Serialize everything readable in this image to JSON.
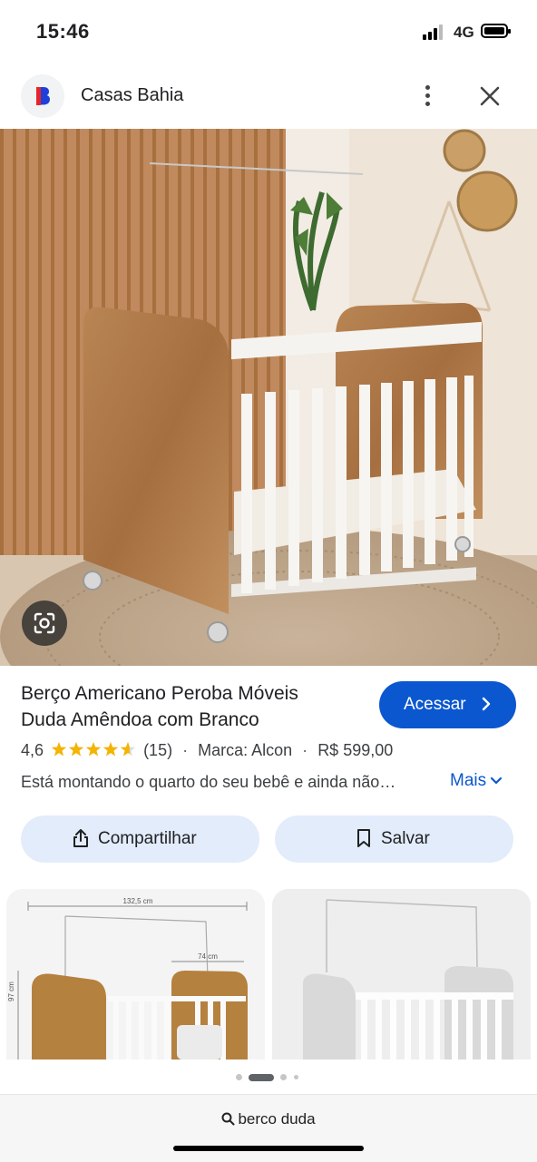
{
  "status_bar": {
    "time": "15:46",
    "network": "4G",
    "signal_bars": 3,
    "signal_bars_total": 4,
    "battery_level": 0.9
  },
  "header": {
    "site_name": "Casas Bahia",
    "logo_letter": "B",
    "logo_color": "#1f3fd9",
    "logo_accent": "#e5252a",
    "more_icon": "more-vert-icon",
    "close_icon": "close-icon"
  },
  "product": {
    "title_line1": "Berço Americano Peroba Móveis",
    "title_line2": "Duda Amêndoa com Branco",
    "access_label": "Acessar",
    "rating": "4,6",
    "rating_value": 4.6,
    "rating_max": 5,
    "review_count": "(15)",
    "brand": "Marca: Alcon",
    "price": "R$ 599,00",
    "separator": "·",
    "description": "Está montando o quarto do seu bebê e ainda não…",
    "more_label": "Mais",
    "accent_color": "#0b57d0",
    "star_color": "#f4b400"
  },
  "actions": {
    "share_label": "Compartilhar",
    "save_label": "Salvar"
  },
  "thumbnails": {
    "dim_width": "132,5 cm",
    "dim_depth": "74 cm",
    "dim_height": "97 cm"
  },
  "carousel": {
    "page_count": 4,
    "active_index": 1
  },
  "search": {
    "query": "berco duda"
  }
}
